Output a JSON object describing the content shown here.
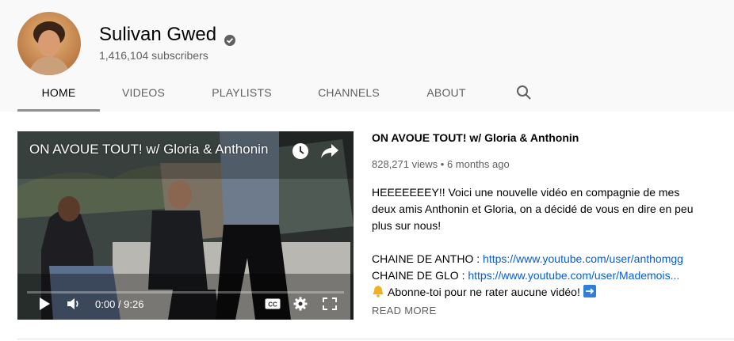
{
  "channel": {
    "name": "Sulivan Gwed",
    "subscribers": "1,416,104 subscribers"
  },
  "tabs": [
    {
      "label": "HOME",
      "active": true
    },
    {
      "label": "VIDEOS",
      "active": false
    },
    {
      "label": "PLAYLISTS",
      "active": false
    },
    {
      "label": "CHANNELS",
      "active": false
    },
    {
      "label": "ABOUT",
      "active": false
    }
  ],
  "player": {
    "title": "ON AVOUE TOUT! w/ Gloria & Anthonin",
    "current_time": "0:00",
    "duration": "9:26",
    "progress": 0
  },
  "video": {
    "title": "ON AVOUE TOUT! w/ Gloria & Anthonin",
    "views": "828,271 views",
    "separator": "•",
    "age": "6 months ago",
    "description_intro": "HEEEEEEEY!! Voici une nouvelle vidéo en compagnie de mes deux amis Anthonin et Gloria, on a décidé de vous en dire en peu plus sur nous!",
    "link1_label": "CHAINE DE ANTHO :",
    "link1_url": "https://www.youtube.com/user/anthomgg",
    "link2_label": "CHAINE DE GLO :",
    "link2_url": "https://www.youtube.com/user/Mademois...",
    "subscribe_line": "Abonne-toi pour ne rater aucune vidéo!",
    "read_more": "READ MORE"
  },
  "colors": {
    "header_bg": "#f9f9f9",
    "link": "#065fd4",
    "active_tab_underline": "#909090",
    "secondary_text": "#606060"
  }
}
